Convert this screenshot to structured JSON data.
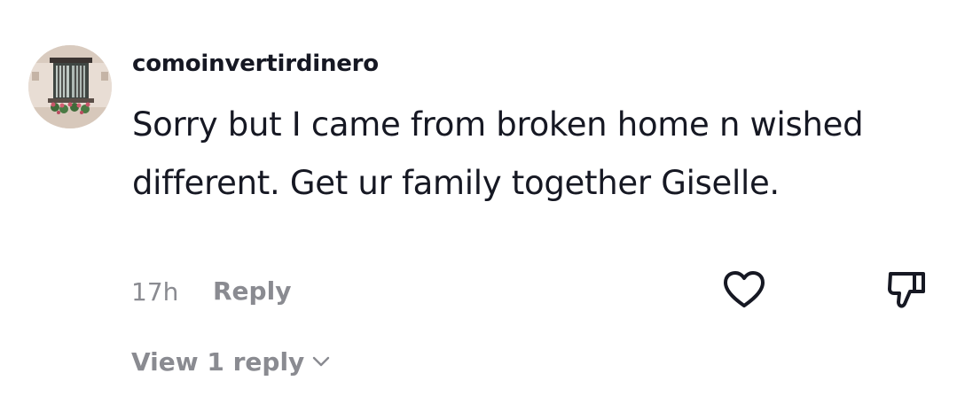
{
  "comment": {
    "username": "comoinvertirdinero",
    "text": "Sorry but I came from broken home n wished different. Get ur family together Giselle.",
    "time": "17h",
    "reply_label": "Reply",
    "view_replies_label": "View 1 reply"
  },
  "icons": {
    "avatar": "avatar-window-photo",
    "like": "heart-icon",
    "dislike": "thumbs-down-icon",
    "expand": "chevron-down-icon"
  },
  "colors": {
    "primary_text": "#161823",
    "secondary_text": "#8a8b91",
    "icon_stroke": "#161823"
  }
}
